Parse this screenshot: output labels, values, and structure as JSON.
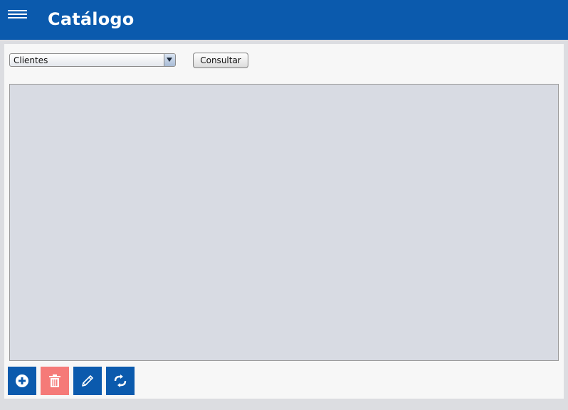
{
  "header": {
    "title": "Catálogo",
    "menu_icon": "hamburger-menu-icon",
    "background": "#0b5aad"
  },
  "filter": {
    "selected_option": "Clientes",
    "consult_label": "Consultar"
  },
  "toolbar": {
    "buttons": [
      {
        "name": "add-button",
        "icon": "plus-circle-icon",
        "color": "#0b5aad"
      },
      {
        "name": "delete-button",
        "icon": "trash-icon",
        "color": "#f57a78"
      },
      {
        "name": "edit-button",
        "icon": "pencil-icon",
        "color": "#0b5aad"
      },
      {
        "name": "refresh-button",
        "icon": "sync-arrows-icon",
        "color": "#0b5aad"
      }
    ]
  }
}
